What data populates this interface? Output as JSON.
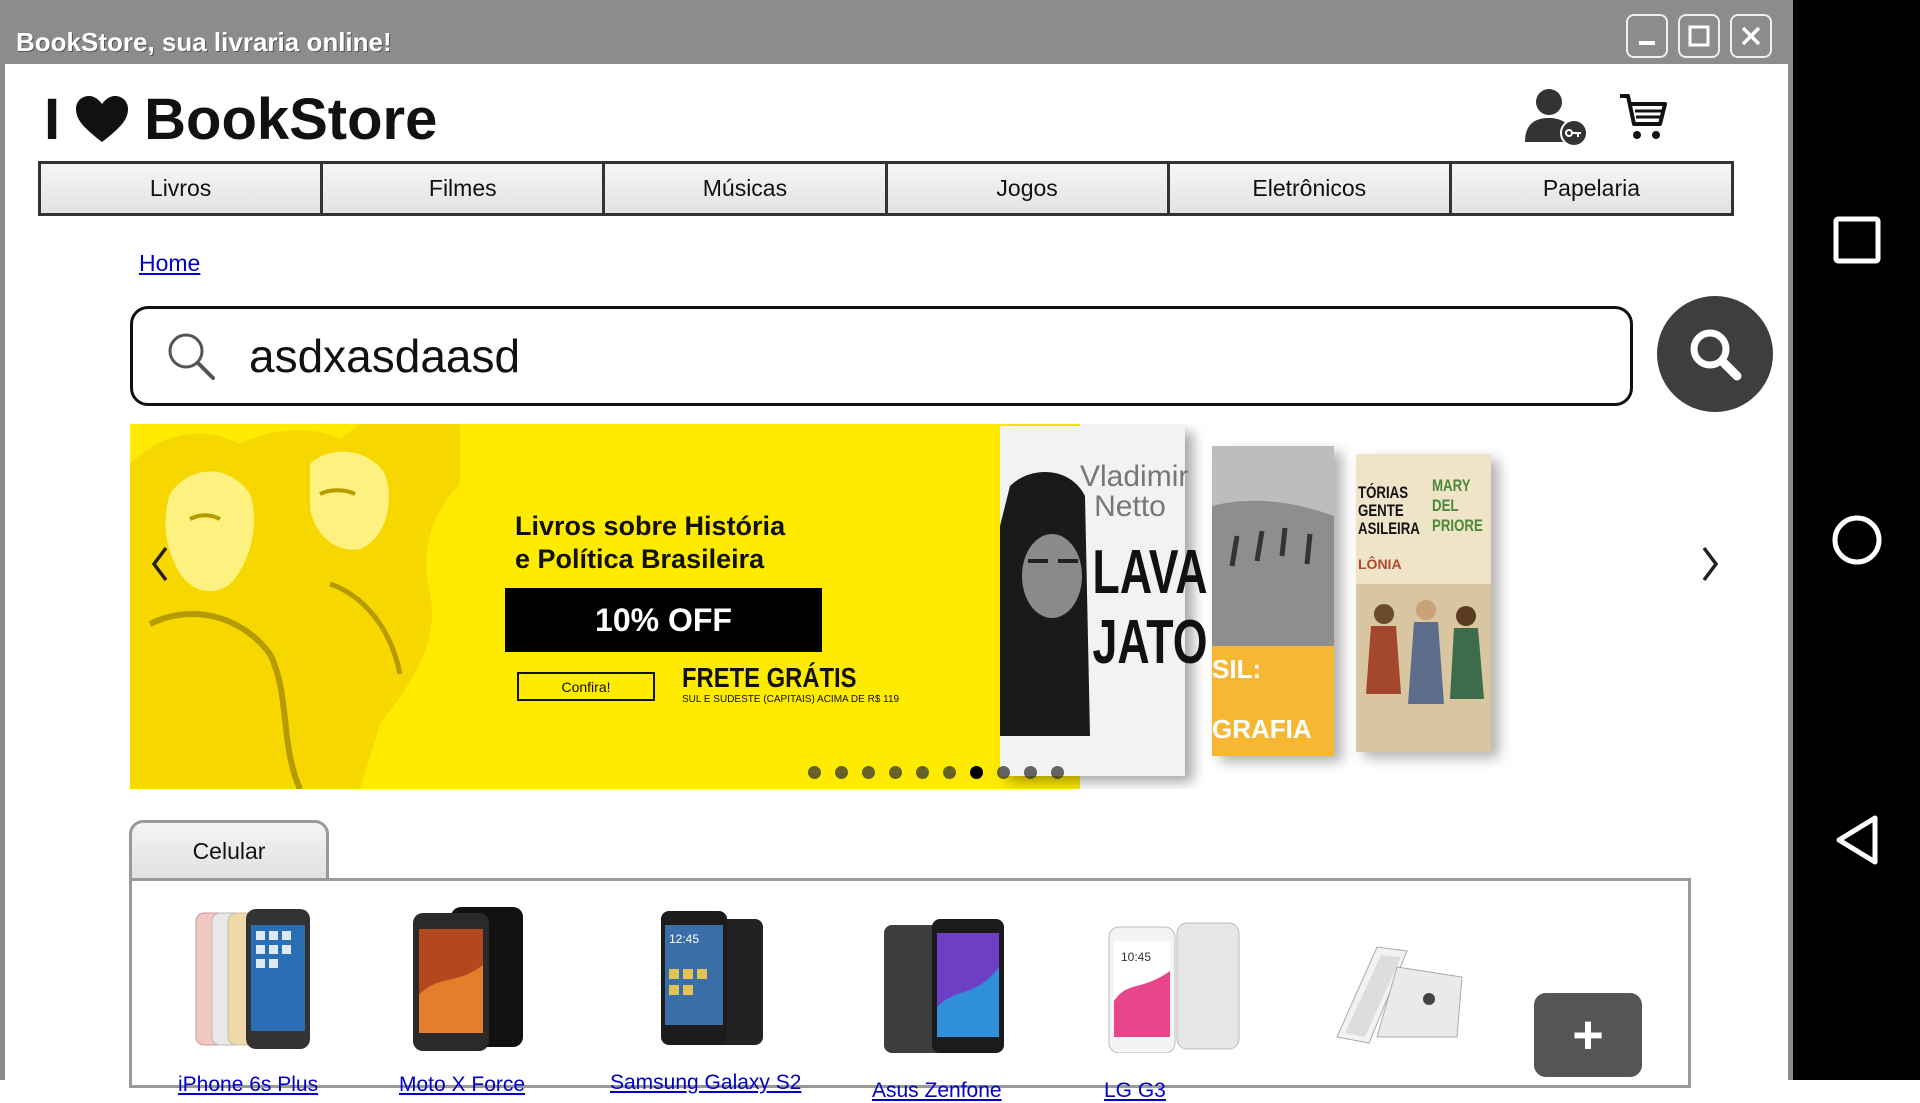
{
  "window": {
    "title": "BookStore, sua livraria online!",
    "buttons": [
      "minimize",
      "maximize",
      "close"
    ]
  },
  "header": {
    "logo_prefix": "I",
    "logo_text": "BookStore",
    "user_icon": "user-key-icon",
    "cart_icon": "cart-icon"
  },
  "nav": {
    "items": [
      "Livros",
      "Filmes",
      "Músicas",
      "Jogos",
      "Eletrônicos",
      "Papelaria"
    ]
  },
  "breadcrumb": {
    "home": "Home"
  },
  "search": {
    "value": "asdxasdaasd",
    "icon": "search-icon",
    "button_icon": "search-icon"
  },
  "banner": {
    "heading_line1": "Livros sobre História",
    "heading_line2": "e Política Brasileira",
    "offer": "10% OFF",
    "cta": "Confira!",
    "shipping": "FRETE GRÁTIS",
    "shipping_note": "SUL E SUDESTE (CAPITAIS) ACIMA DE R$ 119",
    "book1_author_line1": "Vladimir",
    "book1_author_line2": "Netto",
    "book1_title_line1": "LAVA",
    "book1_title_line2": "JATO",
    "book2_title": "SIL:",
    "book2_subtitle": "GRAFIA",
    "book3_title": "TÓRIAS GENTE ASILEIRA",
    "book3_author": "MARY DEL PRIORE",
    "book3_subtitle": "LÔNIA",
    "slides": 10,
    "active_slide": 7
  },
  "products": {
    "tab": "Celular",
    "items": [
      "iPhone 6s Plus",
      "Moto X Force",
      "Samsung Galaxy S2",
      "Asus Zenfone",
      "LG G3",
      ""
    ],
    "more": "+"
  },
  "colors": {
    "banner_yellow": "#ffeb00",
    "titlebar": "#8c8c8c",
    "link": "#0000cc"
  }
}
